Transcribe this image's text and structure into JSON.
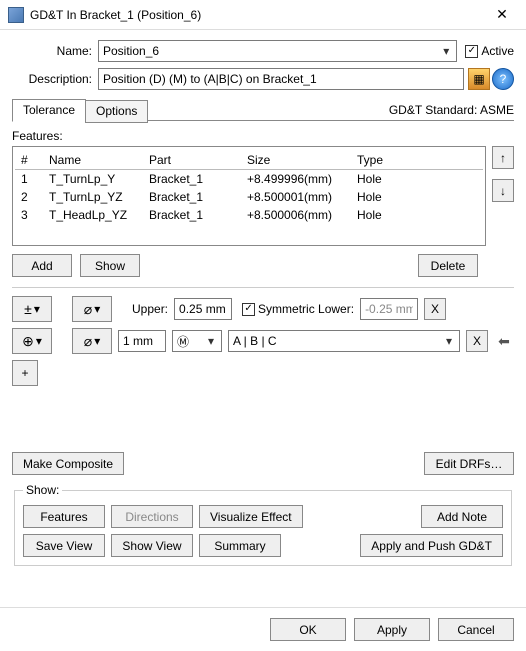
{
  "window": {
    "title": "GD&T In Bracket_1 (Position_6)"
  },
  "form": {
    "name_label": "Name:",
    "name_value": "Position_6",
    "active_label": "Active",
    "active_checked": "✓",
    "description_label": "Description:",
    "description_value": "Position (D) (M) to (A|B|C) on Bracket_1"
  },
  "tabs": {
    "tolerance": "Tolerance",
    "options": "Options",
    "standard": "GD&T Standard: ASME"
  },
  "features": {
    "title": "Features:",
    "headers": {
      "idx": "#",
      "name": "Name",
      "part": "Part",
      "size": "Size",
      "type": "Type"
    },
    "rows": [
      {
        "idx": "1",
        "name": "T_TurnLp_Y",
        "part": "Bracket_1",
        "size": "+8.499996(mm)",
        "type": "Hole"
      },
      {
        "idx": "2",
        "name": "T_TurnLp_YZ",
        "part": "Bracket_1",
        "size": "+8.500001(mm)",
        "type": "Hole"
      },
      {
        "idx": "3",
        "name": "T_HeadLp_YZ",
        "part": "Bracket_1",
        "size": "+8.500006(mm)",
        "type": "Hole"
      }
    ],
    "btn_add": "Add",
    "btn_show": "Show",
    "btn_delete": "Delete",
    "btn_up": "↑",
    "btn_down": "↓"
  },
  "gdt": {
    "upper_label": "Upper:",
    "upper_value": "0.25 mm",
    "symm_label": "Symmetric Lower:",
    "symm_checked": "✓",
    "lower_value": "-0.25 mm",
    "tol_value": "1 mm",
    "mod_value": "Ⓜ",
    "datum_value": "A | B | C",
    "sym_plusminus": "±",
    "sym_diameter": "⌀",
    "sym_position": "⊕",
    "sym_plus": "+",
    "sym_x": "X",
    "arrow_hint": "⬅"
  },
  "composite": {
    "make": "Make Composite",
    "edit_drfs": "Edit DRFs…"
  },
  "show": {
    "title": "Show:",
    "features": "Features",
    "directions": "Directions",
    "visualize": "Visualize Effect",
    "add_note": "Add Note",
    "save_view": "Save View",
    "show_view": "Show View",
    "summary": "Summary",
    "apply_push": "Apply and Push GD&T"
  },
  "footer": {
    "ok": "OK",
    "apply": "Apply",
    "cancel": "Cancel"
  }
}
